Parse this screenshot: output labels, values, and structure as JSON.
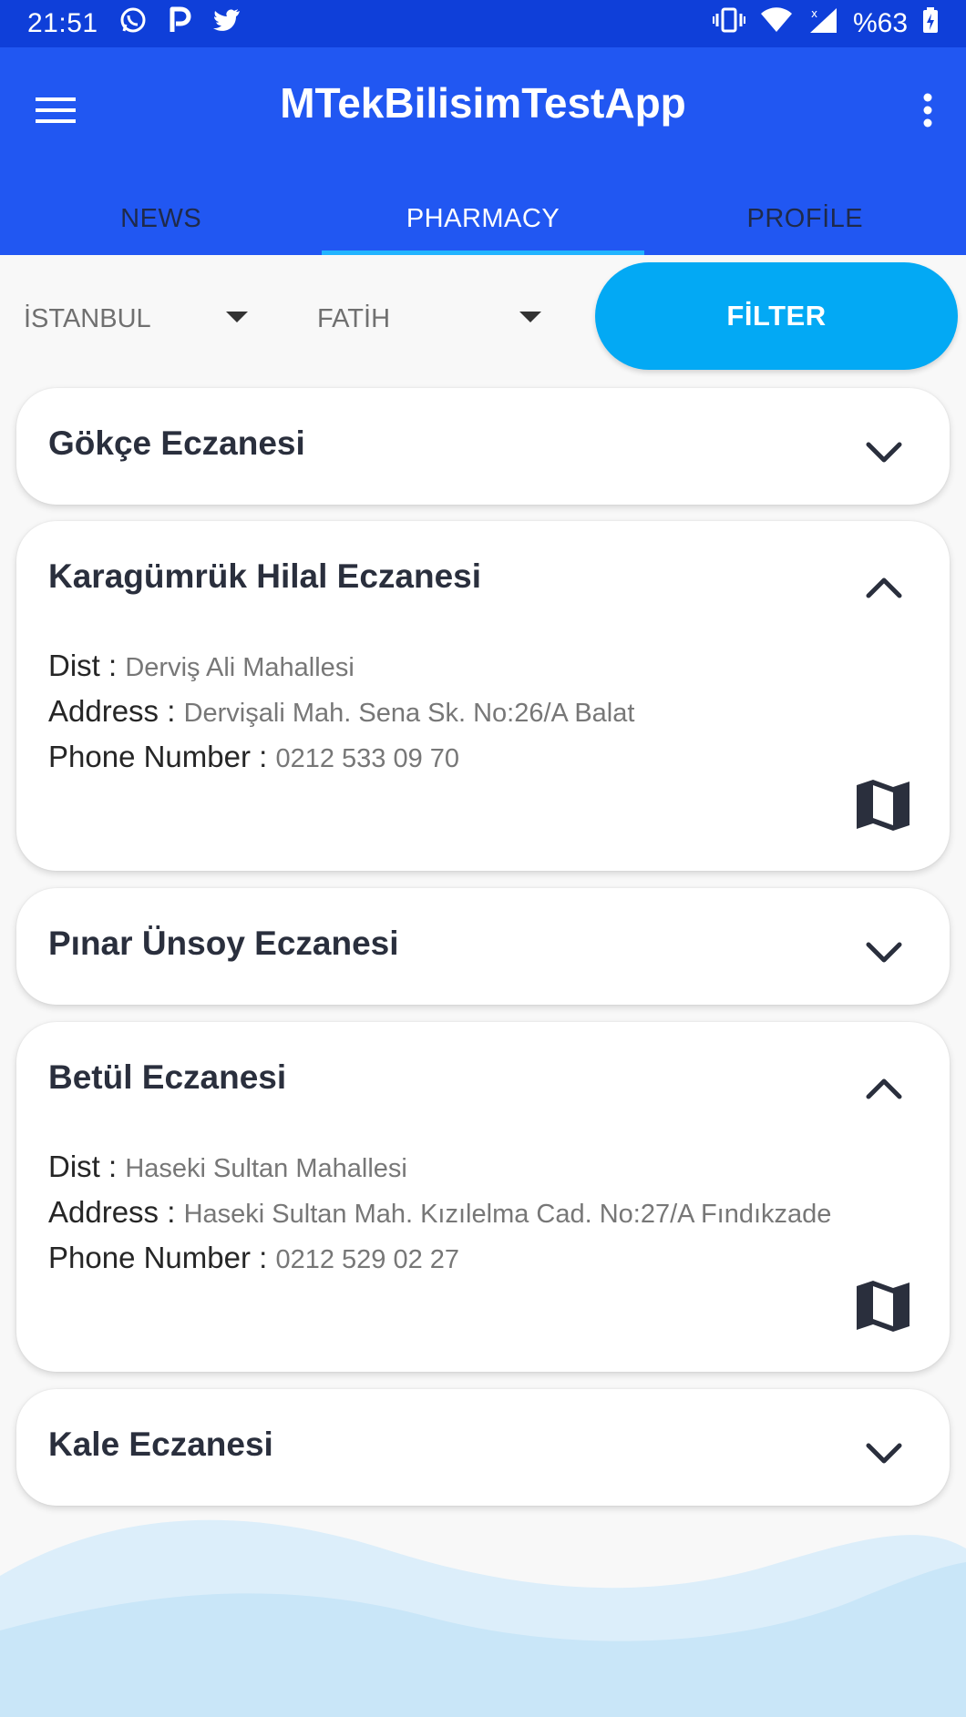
{
  "status_bar": {
    "time": "21:51",
    "battery": "%63",
    "icons_left": [
      "whatsapp-icon",
      "p-icon",
      "twitter-icon"
    ],
    "icons_right": [
      "vibrate-icon",
      "wifi-icon",
      "signal-icon",
      "battery-charging-icon"
    ]
  },
  "app_bar": {
    "title": "MTekBilisimTestApp",
    "tabs": [
      {
        "label": "NEWS",
        "active": false
      },
      {
        "label": "PHARMACY",
        "active": true
      },
      {
        "label": "PROFİLE",
        "active": false
      }
    ]
  },
  "filter": {
    "city": "İSTANBUL",
    "district": "FATİH",
    "button_label": "FİLTER"
  },
  "labels": {
    "dist": "Dist : ",
    "address": "Address : ",
    "phone": "Phone Number : "
  },
  "pharmacies": [
    {
      "name": "Gökçe Eczanesi",
      "expanded": false
    },
    {
      "name": "Karagümrük Hilal Eczanesi",
      "expanded": true,
      "dist": "Derviş Ali Mahallesi",
      "address": "Dervişali Mah. Sena Sk. No:26/A Balat",
      "phone": "0212 533 09 70"
    },
    {
      "name": "Pınar Ünsoy Eczanesi",
      "expanded": false
    },
    {
      "name": "Betül Eczanesi",
      "expanded": true,
      "dist": "Haseki Sultan Mahallesi",
      "address": "Haseki Sultan Mah. Kızılelma Cad. No:27/A Fındıkzade",
      "phone": "0212 529 02 27"
    },
    {
      "name": "Kale Eczanesi",
      "expanded": false
    }
  ],
  "colors": {
    "status_bar": "#0f3fd9",
    "app_bar": "#2157f2",
    "tab_indicator": "#22b4ff",
    "filter_button": "#03a9f4",
    "wave_light": "#dceefa",
    "wave_dark": "#c9e6f8"
  }
}
